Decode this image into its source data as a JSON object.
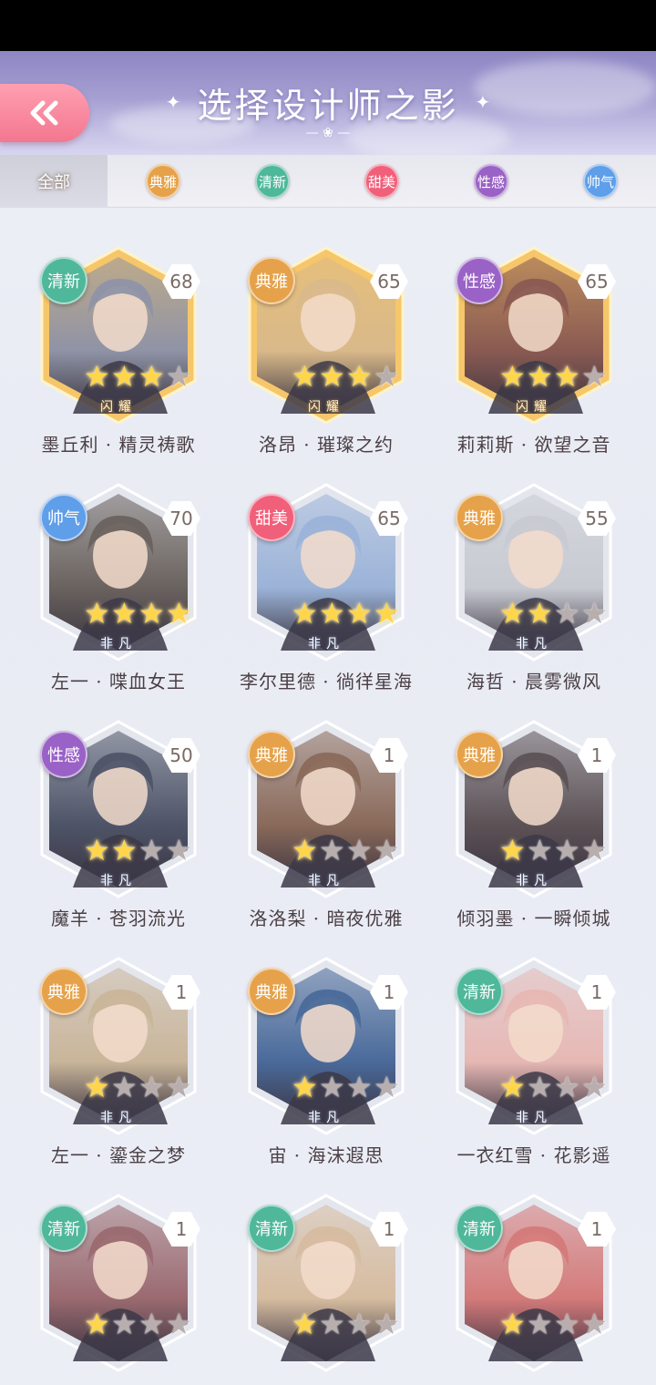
{
  "header": {
    "title": "选择设计师之影",
    "back_icon": "double-chevron-left-icon",
    "accent": "#f3778f"
  },
  "filters": [
    {
      "label": "全部",
      "color": "#b8a098",
      "active": true
    },
    {
      "label": "典雅",
      "color": "#e6a24a",
      "active": false
    },
    {
      "label": "清新",
      "color": "#4fb79a",
      "active": false
    },
    {
      "label": "甜美",
      "color": "#f0607a",
      "active": false
    },
    {
      "label": "性感",
      "color": "#9a62c6",
      "active": false
    },
    {
      "label": "帅气",
      "color": "#5f9ee8",
      "active": false
    }
  ],
  "cards": [
    {
      "category": "清新",
      "cat_color": "#4fb79a",
      "level": "68",
      "stars": 3,
      "name": "墨丘利 · 精灵祷歌",
      "frame": "gold",
      "banner": "闪耀",
      "portrait": "#8f93a6"
    },
    {
      "category": "典雅",
      "cat_color": "#e6a24a",
      "level": "65",
      "stars": 3,
      "name": "洛昂 · 璀璨之约",
      "frame": "gold",
      "banner": "闪耀",
      "portrait": "#d9b98a"
    },
    {
      "category": "性感",
      "cat_color": "#9a62c6",
      "level": "65",
      "stars": 3,
      "name": "莉莉斯 · 欲望之音",
      "frame": "gold",
      "banner": "闪耀",
      "portrait": "#8a5a52"
    },
    {
      "category": "帅气",
      "cat_color": "#5f9ee8",
      "level": "70",
      "stars": 4,
      "name": "左一 · 喋血女王",
      "frame": "silver",
      "banner": "非凡",
      "portrait": "#6a625e"
    },
    {
      "category": "甜美",
      "cat_color": "#f0607a",
      "level": "65",
      "stars": 4,
      "name": "李尔里德 · 徜徉星海",
      "frame": "silver",
      "banner": "非凡",
      "portrait": "#9bb3d8"
    },
    {
      "category": "典雅",
      "cat_color": "#e6a24a",
      "level": "55",
      "stars": 2,
      "name": "海哲 · 晨雾微风",
      "frame": "silver",
      "banner": "非凡",
      "portrait": "#c8cad2"
    },
    {
      "category": "性感",
      "cat_color": "#9a62c6",
      "level": "50",
      "stars": 2,
      "name": "魔羊 · 苍羽流光",
      "frame": "silver",
      "banner": "非凡",
      "portrait": "#4e5468"
    },
    {
      "category": "典雅",
      "cat_color": "#e6a24a",
      "level": "1",
      "stars": 1,
      "name": "洛洛梨 · 暗夜优雅",
      "frame": "silver",
      "banner": "非凡",
      "portrait": "#8a6a5a"
    },
    {
      "category": "典雅",
      "cat_color": "#e6a24a",
      "level": "1",
      "stars": 1,
      "name": "倾羽墨 · 一瞬倾城",
      "frame": "silver",
      "banner": "非凡",
      "portrait": "#5c5256"
    },
    {
      "category": "典雅",
      "cat_color": "#e6a24a",
      "level": "1",
      "stars": 1,
      "name": "左一 · 鎏金之梦",
      "frame": "silver",
      "banner": "非凡",
      "portrait": "#c9b59a"
    },
    {
      "category": "典雅",
      "cat_color": "#e6a24a",
      "level": "1",
      "stars": 1,
      "name": "宙 · 海沫遐思",
      "frame": "silver",
      "banner": "非凡",
      "portrait": "#4a6a9a"
    },
    {
      "category": "清新",
      "cat_color": "#4fb79a",
      "level": "1",
      "stars": 1,
      "name": "一衣红雪 · 花影遥",
      "frame": "silver",
      "banner": "非凡",
      "portrait": "#e6b8b4"
    },
    {
      "category": "清新",
      "cat_color": "#4fb79a",
      "level": "1",
      "stars": 1,
      "name": "",
      "frame": "silver",
      "banner": "",
      "portrait": "#9a6a70"
    },
    {
      "category": "清新",
      "cat_color": "#4fb79a",
      "level": "1",
      "stars": 1,
      "name": "",
      "frame": "silver",
      "banner": "",
      "portrait": "#d6bca0"
    },
    {
      "category": "清新",
      "cat_color": "#4fb79a",
      "level": "1",
      "stars": 1,
      "name": "",
      "frame": "silver",
      "banner": "",
      "portrait": "#d47a7a"
    }
  ]
}
